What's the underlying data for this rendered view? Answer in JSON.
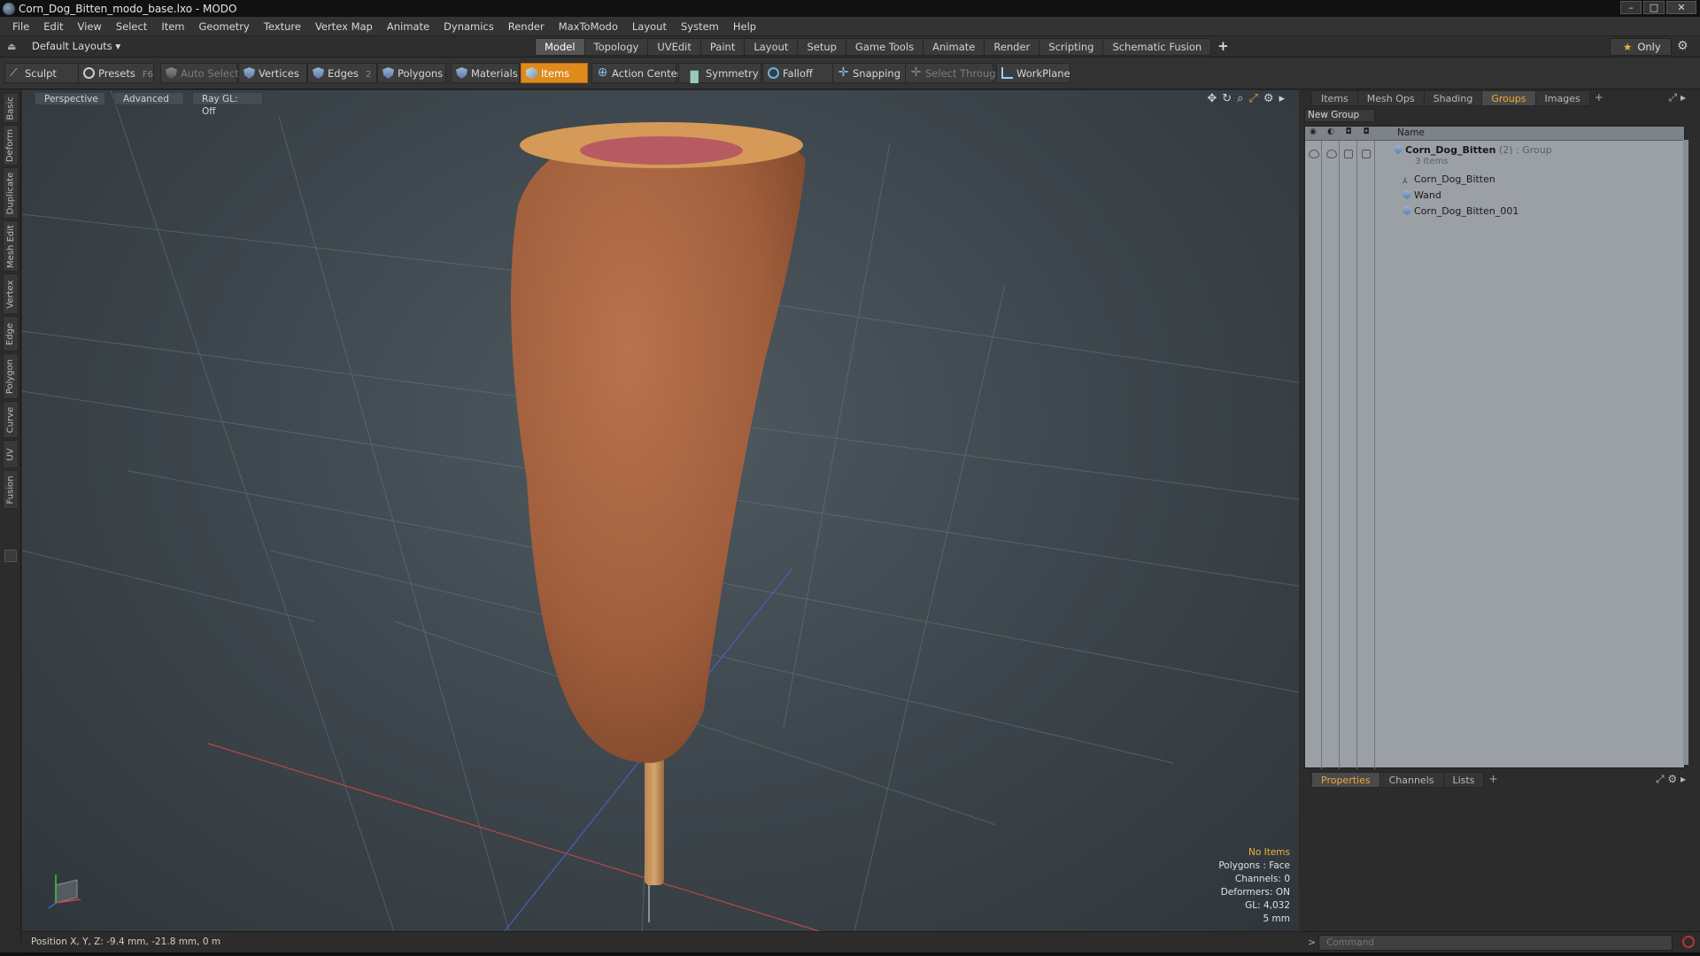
{
  "window": {
    "title": "Corn_Dog_Bitten_modo_base.lxo - MODO",
    "controls": [
      "–",
      "□",
      "✕"
    ]
  },
  "menu": [
    "File",
    "Edit",
    "View",
    "Select",
    "Item",
    "Geometry",
    "Texture",
    "Vertex Map",
    "Animate",
    "Dynamics",
    "Render",
    "MaxToModo",
    "Layout",
    "System",
    "Help"
  ],
  "layoutbar": {
    "layout_select": "Default Layouts ▾",
    "tabs": [
      "Model",
      "Topology",
      "UVEdit",
      "Paint",
      "Layout",
      "Setup",
      "Game Tools",
      "Animate",
      "Render",
      "Scripting",
      "Schematic Fusion"
    ],
    "active_tab": "Model",
    "add": "+",
    "only_label": "Only"
  },
  "toolbar": {
    "sculpt": "Sculpt",
    "presets": "Presets",
    "presets_hotkey": "F6",
    "auto_select": "Auto Select",
    "vertices": "Vertices",
    "vertices_hotkey": "1",
    "edges": "Edges",
    "edges_hotkey": "2",
    "polygons": "Polygons",
    "materials": "Materials",
    "items": "Items",
    "items_hotkey": "5",
    "action_center": "Action Center",
    "symmetry": "Symmetry",
    "falloff": "Falloff",
    "snapping": "Snapping",
    "select_through": "Select Through",
    "workplane": "WorkPlane"
  },
  "left_tabs": [
    "Basic",
    "Deform",
    "Duplicate",
    "Mesh Edit",
    "Vertex",
    "Edge",
    "Polygon",
    "Curve",
    "UV",
    "Fusion"
  ],
  "viewport": {
    "view": "Perspective",
    "mode": "Advanced",
    "raygl": "Ray GL: Off",
    "info": {
      "items": "No Items",
      "polygons": "Polygons : Face",
      "channels": "Channels: 0",
      "deformers": "Deformers: ON",
      "gl": "GL: 4,032",
      "scale": "5 mm"
    }
  },
  "status": {
    "position": "Position X, Y, Z:  -9.4 mm, -21.8 mm, 0 m"
  },
  "right_panel": {
    "tabs": [
      "Items",
      "Mesh Ops",
      "Shading",
      "Groups",
      "Images"
    ],
    "active_tab": "Groups",
    "add": "+",
    "new_group": "New Group",
    "name_header": "Name",
    "group": {
      "name": "Corn_Dog_Bitten",
      "suffix": " (2) : Group",
      "count": "3 Items",
      "children": [
        "Corn_Dog_Bitten",
        "Wand",
        "Corn_Dog_Bitten_001"
      ]
    }
  },
  "properties_panel": {
    "tabs": [
      "Properties",
      "Channels",
      "Lists"
    ],
    "active_tab": "Properties",
    "add": "+"
  },
  "command": {
    "prompt": ">",
    "placeholder": "Command"
  },
  "colors": {
    "accent": "#e08a1c",
    "active_tab_text": "#f2a839",
    "viewport_bg": "#3b444a",
    "tree_bg": "#9aa0a5"
  }
}
